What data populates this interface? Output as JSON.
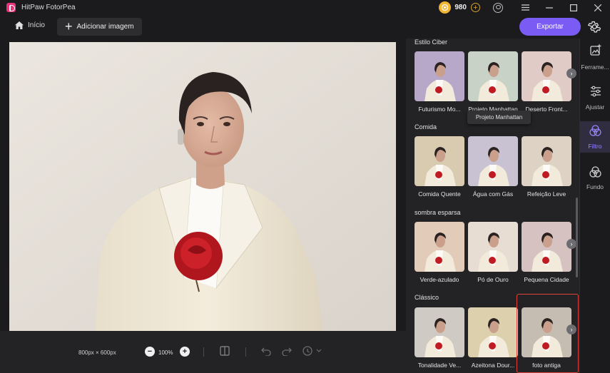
{
  "app": {
    "title": "HitPaw FotorPea"
  },
  "titlebar": {
    "credits": "980",
    "add_credits_icon": "plus-circle-icon",
    "user_icon": "user-icon",
    "menu_icon": "hamburger-icon",
    "minimize_icon": "minimize-icon",
    "maximize_icon": "maximize-icon",
    "close_icon": "close-icon"
  },
  "toolbar": {
    "home_label": "Início",
    "add_label": "Adicionar imagem",
    "export_label": "Exportar"
  },
  "canvas": {
    "size_label": "800px × 600px",
    "zoom_label": "100%"
  },
  "panel": {
    "categories": [
      {
        "title": "Estilo Ciber",
        "items": [
          "Futurismo Mo...",
          "Projeto Manhattan",
          "Deserto Front..."
        ]
      },
      {
        "title": "Comida",
        "items": [
          "Comida Quente",
          "Água com Gás",
          "Refeição Leve"
        ]
      },
      {
        "title": "sombra esparsa",
        "items": [
          "Verde-azulado",
          "Pó de Ouro",
          "Pequena Cidade"
        ]
      },
      {
        "title": "Clássico",
        "items": [
          "Tonalidade Ve...",
          "Azeitona Dour...",
          "foto antiga"
        ]
      }
    ],
    "tooltip": "Projeto Manhattan",
    "selected": "foto antiga"
  },
  "nav": {
    "items": [
      "Ferrame...",
      "Ajustar",
      "Filtro",
      "Fundo"
    ],
    "active": "Filtro"
  },
  "colors": {
    "accent": "#7a5cf5",
    "selection": "#e0433d",
    "coin": "#f3b533"
  }
}
